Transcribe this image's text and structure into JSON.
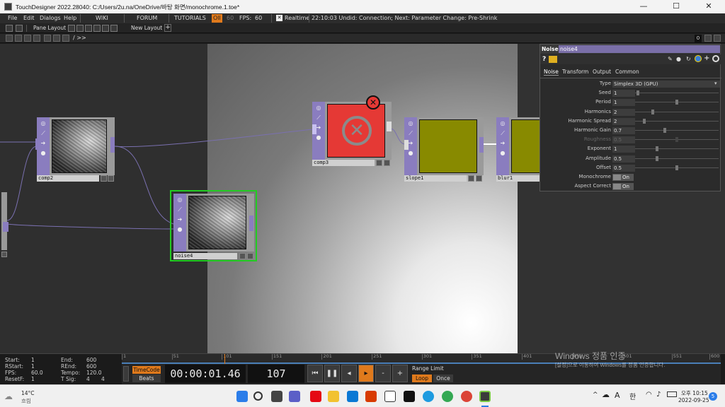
{
  "window": {
    "title": "TouchDesigner 2022.28040: C:/Users/2u.na/OneDrive/바탕 화면/monochrome.1.toe*",
    "minimize": "—",
    "maximize": "☐",
    "close": "✕"
  },
  "menu": {
    "file": "File",
    "edit": "Edit",
    "dialogs": "Dialogs",
    "help": "Help",
    "wiki": "WIKI",
    "forum": "FORUM",
    "tutorials": "TUTORIALS",
    "ocl": "Oll",
    "fps_target": "60",
    "fps_label": "FPS:",
    "fps_value": "60",
    "realtime": "Realtime",
    "status": "22:10:03 Undid: Connection; Next: Parameter Change: Pre-Shrink"
  },
  "panebar": {
    "pane_layout": "Pane Layout",
    "new_layout": "New Layout",
    "add": "+"
  },
  "pathbar": {
    "path": "/ >>",
    "right_value": "0"
  },
  "nodes": {
    "comp2": "comp2",
    "noise4": "noise4",
    "comp3": "comp3",
    "slope1": "slope1",
    "blur1": "blur1"
  },
  "params": {
    "op_type": "Noise",
    "op_name": "noise4",
    "tabs": [
      "Noise",
      "Transform",
      "Output",
      "Common"
    ],
    "rows": [
      {
        "label": "Type",
        "value": "Simplex 3D (GPU)",
        "kind": "dropdown"
      },
      {
        "label": "Seed",
        "value": "1",
        "kind": "slider",
        "pos": 0.02
      },
      {
        "label": "Period",
        "value": "1",
        "kind": "slider",
        "pos": 0.5
      },
      {
        "label": "Harmonics",
        "value": "2",
        "kind": "slider",
        "pos": 0.2
      },
      {
        "label": "Harmonic Spread",
        "value": "2",
        "kind": "slider",
        "pos": 0.1
      },
      {
        "label": "Harmonic Gain",
        "value": "0.7",
        "kind": "slider",
        "pos": 0.35
      },
      {
        "label": "Roughness",
        "value": "0.5",
        "kind": "slider",
        "pos": 0.5,
        "dim": true
      },
      {
        "label": "Exponent",
        "value": "1",
        "kind": "slider",
        "pos": 0.25
      },
      {
        "label": "Amplitude",
        "value": "0.5",
        "kind": "slider",
        "pos": 0.25
      },
      {
        "label": "Offset",
        "value": "0.5",
        "kind": "slider",
        "pos": 0.5
      },
      {
        "label": "Monochrome",
        "value": "On",
        "kind": "toggle"
      },
      {
        "label": "Aspect Correct",
        "value": "On",
        "kind": "toggle"
      }
    ]
  },
  "timeline": {
    "start_label": "Start:",
    "start_value": "1",
    "rstart_label": "RStart:",
    "rstart_value": "1",
    "fps_label": "FPS:",
    "fps_value": "60.0",
    "resetf_label": "ResetF:",
    "resetf_value": "1",
    "end_label": "End:",
    "end_value": "600",
    "rend_label": "REnd:",
    "rend_value": "600",
    "tempo_label": "Tempo:",
    "tempo_value": "120.0",
    "tsig_label": "T Sig:",
    "tsig_a": "4",
    "tsig_b": "4",
    "ticks": [
      "1",
      "51",
      "101",
      "151",
      "201",
      "251",
      "301",
      "351",
      "401",
      "451",
      "501",
      "551",
      "600"
    ],
    "timecode_label": "TimeCode",
    "beats_label": "Beats",
    "timecode": "00:00:01.46",
    "frame": "107",
    "minus": "-",
    "plus": "+",
    "range_limit": "Range Limit",
    "loop": "Loop",
    "once": "Once"
  },
  "watermark": {
    "line1": "Windows 정품 인증",
    "line2": "[설정]으로 이동하여 Windows를 정품 인증합니다."
  },
  "taskbar": {
    "temperature": "14°C",
    "weather": "흐림",
    "ime_a": "A",
    "ime_han": "한",
    "time": "오후 10:15",
    "date": "2022-09-25",
    "notifications": "5",
    "chevron": "^"
  },
  "colors": {
    "operator_purple": "#8a7dbf",
    "error_red": "#e53935",
    "selected_green": "#22cc22",
    "accent_orange": "#e07a1c"
  }
}
